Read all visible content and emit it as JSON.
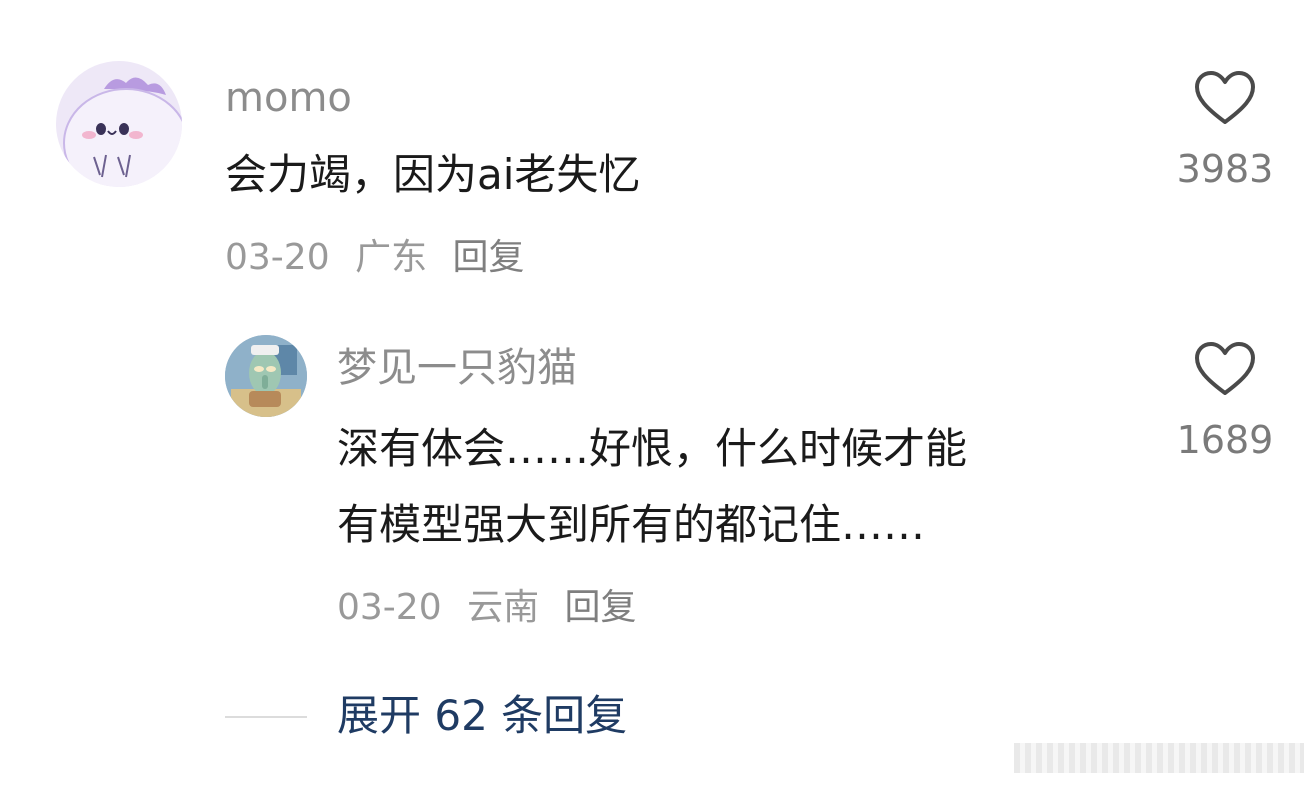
{
  "comment": {
    "username": "momo",
    "text": "会力竭，因为ai老失忆",
    "date": "03-20",
    "location": "广东",
    "reply_label": "回复",
    "like_count": "3983",
    "avatar_icon": "cute-purple-dino-avatar",
    "like_icon": "heart-outline-icon"
  },
  "reply": {
    "username": "梦见一只豹猫",
    "text_lines": [
      "深有体会……好恨，什么时候才能",
      "有模型强大到所有的都记住……"
    ],
    "date": "03-20",
    "location": "云南",
    "reply_label": "回复",
    "like_count": "1689",
    "avatar_icon": "cartoon-character-avatar",
    "like_icon": "heart-outline-icon"
  },
  "expand": {
    "label": "展开 62 条回复"
  },
  "colors": {
    "username": "#8c8c8c",
    "text": "#1a1a1a",
    "meta": "#999999",
    "expand_link": "#1f3b63"
  }
}
